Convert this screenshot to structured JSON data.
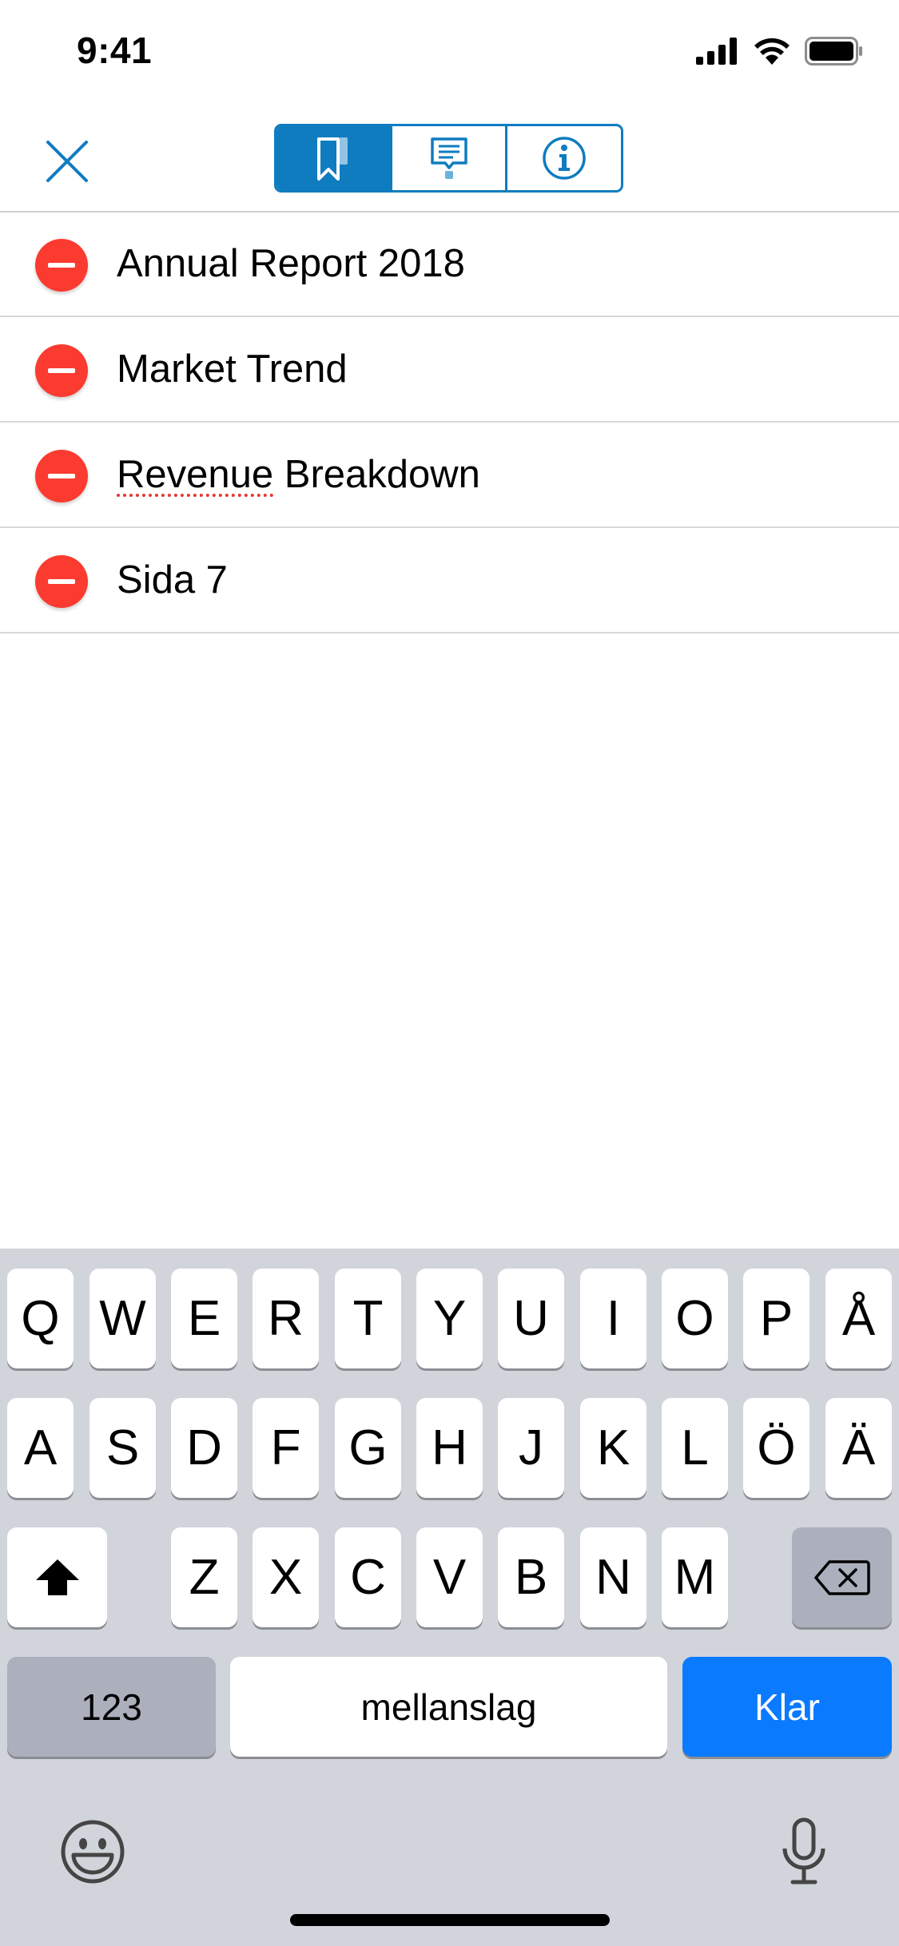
{
  "status_bar": {
    "time": "9:41"
  },
  "nav": {
    "close_icon": "close-x-icon",
    "segments": [
      {
        "icon": "bookmark-icon",
        "selected": true
      },
      {
        "icon": "comment-icon",
        "selected": false
      },
      {
        "icon": "info-icon",
        "selected": false
      }
    ],
    "accent_color": "#0f7cc0"
  },
  "list": {
    "items": [
      {
        "label": "Annual Report 2018"
      },
      {
        "label_spellcheck": "Revenue",
        "label": "Market Trend"
      },
      {
        "label_part1": "Revenue",
        "label_part2": " Breakdown"
      },
      {
        "label": "Sida 7"
      }
    ],
    "delete_color": "#fb3b30"
  },
  "keyboard": {
    "row1": [
      "Q",
      "W",
      "E",
      "R",
      "T",
      "Y",
      "U",
      "I",
      "O",
      "P",
      "Å"
    ],
    "row2": [
      "A",
      "S",
      "D",
      "F",
      "G",
      "H",
      "J",
      "K",
      "L",
      "Ö",
      "Ä"
    ],
    "row3": [
      "Z",
      "X",
      "C",
      "V",
      "B",
      "N",
      "M"
    ],
    "numbers_label": "123",
    "space_label": "mellanslag",
    "return_label": "Klar",
    "return_color": "#0a7aff"
  }
}
